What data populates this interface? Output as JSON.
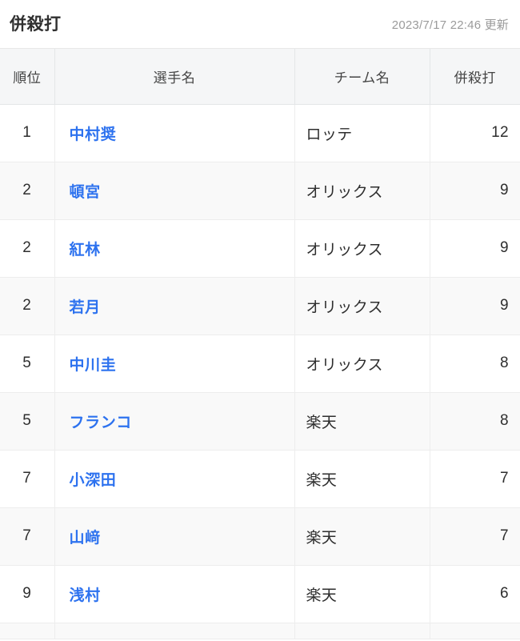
{
  "header": {
    "title": "併殺打",
    "updated_at": "2023/7/17 22:46 更新"
  },
  "table": {
    "columns": [
      {
        "key": "rank",
        "label": "順位"
      },
      {
        "key": "name",
        "label": "選手名"
      },
      {
        "key": "team",
        "label": "チーム名"
      },
      {
        "key": "value",
        "label": "併殺打"
      }
    ],
    "rows": [
      {
        "rank": "1",
        "name": "中村奨",
        "team": "ロッテ",
        "value": "12"
      },
      {
        "rank": "2",
        "name": "頓宮",
        "team": "オリックス",
        "value": "9"
      },
      {
        "rank": "2",
        "name": "紅林",
        "team": "オリックス",
        "value": "9"
      },
      {
        "rank": "2",
        "name": "若月",
        "team": "オリックス",
        "value": "9"
      },
      {
        "rank": "5",
        "name": "中川圭",
        "team": "オリックス",
        "value": "8"
      },
      {
        "rank": "5",
        "name": "フランコ",
        "team": "楽天",
        "value": "8"
      },
      {
        "rank": "7",
        "name": "小深田",
        "team": "楽天",
        "value": "7"
      },
      {
        "rank": "7",
        "name": "山﨑",
        "team": "楽天",
        "value": "7"
      },
      {
        "rank": "9",
        "name": "浅村",
        "team": "楽天",
        "value": "6"
      }
    ]
  },
  "colors": {
    "link": "#2d72ef",
    "header_bg": "#f5f6f7",
    "row_alt_bg": "#f9f9f9",
    "border": "#ededed",
    "muted_text": "#9b9b9b",
    "title_text": "#303030"
  }
}
